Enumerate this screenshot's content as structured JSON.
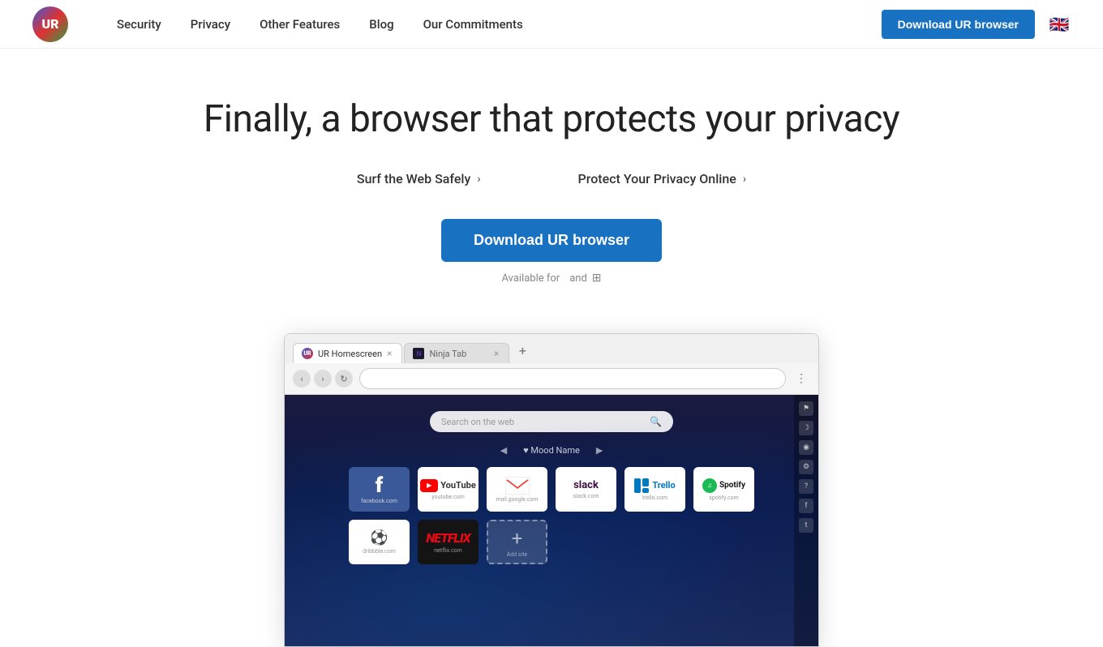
{
  "nav": {
    "logo_text": "UR",
    "links": [
      {
        "label": "Security",
        "id": "security"
      },
      {
        "label": "Privacy",
        "id": "privacy"
      },
      {
        "label": "Other Features",
        "id": "other-features"
      },
      {
        "label": "Blog",
        "id": "blog"
      },
      {
        "label": "Our Commitments",
        "id": "our-commitments"
      }
    ],
    "download_button": "Download UR browser",
    "flag_emoji": "🇬🇧"
  },
  "hero": {
    "title": "Finally, a browser that protects your privacy",
    "link1_text": "Surf the Web Safely",
    "link2_text": "Protect Your Privacy Online",
    "download_button": "Download UR browser",
    "available_prefix": "Available for",
    "available_and": "and"
  },
  "browser_mockup": {
    "tab1_label": "UR Homescreen",
    "tab2_label": "Ninja Tab",
    "tab_new": "+",
    "search_placeholder": "Search on the web",
    "mood_left": "◀",
    "mood_label": "♥ Mood Name",
    "mood_right": "▶",
    "speed_dial": [
      {
        "name": "Facebook",
        "domain": "facebook.com",
        "type": "facebook"
      },
      {
        "name": "YouTube",
        "domain": "youtube.com",
        "type": "youtube"
      },
      {
        "name": "Gmail",
        "domain": "mail.google.com",
        "type": "gmail"
      },
      {
        "name": "Slack",
        "domain": "slack.com",
        "type": "slack"
      },
      {
        "name": "Trello",
        "domain": "trello.com",
        "type": "trello"
      },
      {
        "name": "Spotify",
        "domain": "spotify.com",
        "type": "spotify"
      },
      {
        "name": "Dribbble",
        "domain": "dribbble.com",
        "type": "dribbble"
      },
      {
        "name": "Netflix",
        "domain": "netflix.com",
        "type": "netflix"
      },
      {
        "name": "Add site",
        "domain": "Add site",
        "type": "add"
      }
    ]
  }
}
